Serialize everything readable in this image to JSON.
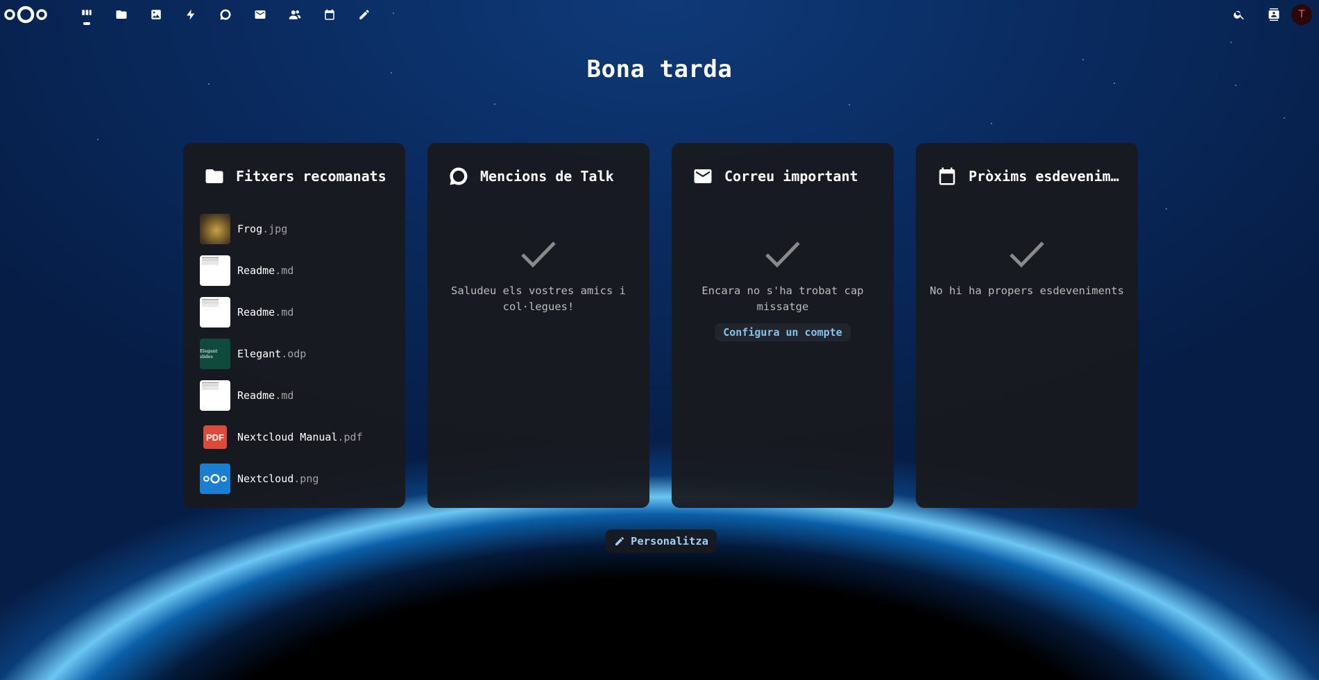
{
  "header": {
    "nav": [
      {
        "icon": "dashboard-icon",
        "label": "Tauler",
        "active": true
      },
      {
        "icon": "folder-icon",
        "label": "Fitxers"
      },
      {
        "icon": "image-icon",
        "label": "Fotos"
      },
      {
        "icon": "activity-icon",
        "label": "Activitat"
      },
      {
        "icon": "talk-icon",
        "label": "Talk"
      },
      {
        "icon": "mail-icon",
        "label": "Correu"
      },
      {
        "icon": "contacts-icon",
        "label": "Contactes"
      },
      {
        "icon": "calendar-icon",
        "label": "Calendari"
      },
      {
        "icon": "notes-icon",
        "label": "Notes"
      }
    ],
    "avatar_letter": "T"
  },
  "greeting": "Bona tarda",
  "panels": {
    "files": {
      "title": "Fitxers recomanats",
      "items": [
        {
          "name": "Frog",
          "ext": ".jpg",
          "thumb": "frog"
        },
        {
          "name": "Readme",
          "ext": ".md",
          "thumb": "doc"
        },
        {
          "name": "Readme",
          "ext": ".md",
          "thumb": "doc"
        },
        {
          "name": "Elegant",
          "ext": ".odp",
          "thumb": "odp",
          "thumb_text": "Elegant slides"
        },
        {
          "name": "Readme",
          "ext": ".md",
          "thumb": "doc"
        },
        {
          "name": "Nextcloud Manual",
          "ext": ".pdf",
          "thumb": "pdf",
          "thumb_text": "PDF"
        },
        {
          "name": "Nextcloud",
          "ext": ".png",
          "thumb": "nc"
        }
      ]
    },
    "talk": {
      "title": "Mencions de Talk",
      "empty_text": "Saludeu els vostres amics i col·legues!"
    },
    "mail": {
      "title": "Correu important",
      "empty_text": "Encara no s'ha trobat cap missatge",
      "action_label": "Configura un compte"
    },
    "calendar": {
      "title": "Pròxims esdeveniments",
      "empty_text": "No hi ha propers esdeveniments"
    }
  },
  "customize_label": "Personalitza",
  "colors": {
    "background": "#0a2c62",
    "panel": "#181a1e",
    "link": "#7fc3f0",
    "avatar_text": "#e8595b"
  }
}
